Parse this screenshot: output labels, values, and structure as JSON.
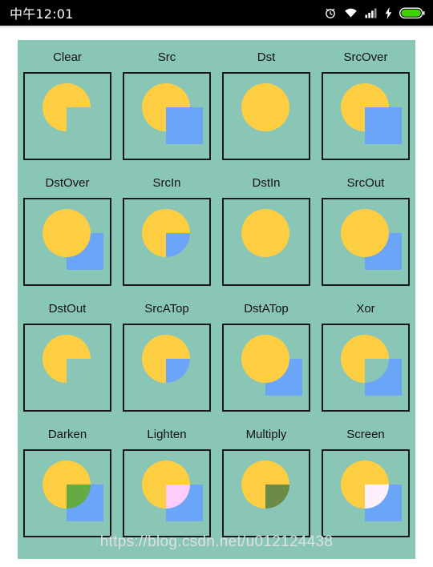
{
  "statusbar": {
    "clock": "中午12:01",
    "icons": [
      {
        "name": "alarm-icon",
        "label": "alarm"
      },
      {
        "name": "wifi-icon",
        "label": "wifi"
      },
      {
        "name": "signal-icon",
        "label": "signal"
      },
      {
        "name": "charging-bolt-icon",
        "label": "charging"
      },
      {
        "name": "battery-icon",
        "label": "battery"
      }
    ],
    "battery_color": "#3FD000"
  },
  "colors": {
    "panel_background": "#8AC6B6",
    "circle_yellow": "#FDCE42",
    "square_blue": "#6BA5F8",
    "darken_overlap": "#63AB42",
    "lighten_overlap": "#FFCBFA",
    "multiply_overlap": "#6C8B46",
    "screen_overlap": "#FDEFFB",
    "box_border": "#1a1a1a"
  },
  "grid": {
    "columns": 4,
    "rows": 4,
    "cells": [
      {
        "label": "Clear",
        "mode": "clear"
      },
      {
        "label": "Src",
        "mode": "src"
      },
      {
        "label": "Dst",
        "mode": "dst"
      },
      {
        "label": "SrcOver",
        "mode": "srcover"
      },
      {
        "label": "DstOver",
        "mode": "dstover"
      },
      {
        "label": "SrcIn",
        "mode": "srcin"
      },
      {
        "label": "DstIn",
        "mode": "dstin"
      },
      {
        "label": "SrcOut",
        "mode": "srcout"
      },
      {
        "label": "DstOut",
        "mode": "dstout"
      },
      {
        "label": "SrcATop",
        "mode": "srcatop"
      },
      {
        "label": "DstATop",
        "mode": "dstatop"
      },
      {
        "label": "Xor",
        "mode": "xor"
      },
      {
        "label": "Darken",
        "mode": "darken"
      },
      {
        "label": "Lighten",
        "mode": "lighten"
      },
      {
        "label": "Multiply",
        "mode": "multiply"
      },
      {
        "label": "Screen",
        "mode": "screen"
      }
    ]
  },
  "watermark": {
    "text": "https://blog.csdn.net/u012124438"
  }
}
